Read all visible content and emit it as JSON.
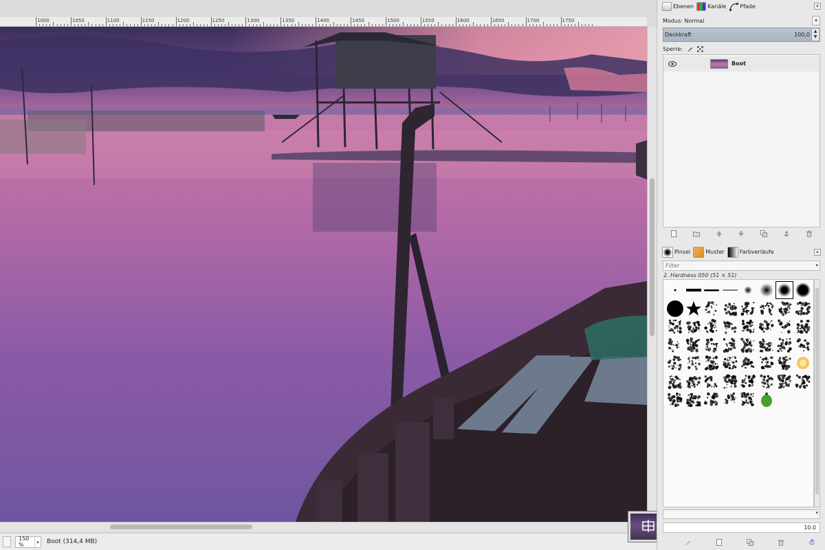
{
  "canvas": {
    "ruler_labels": [
      "1000",
      "1050",
      "1100",
      "1150",
      "1200",
      "1250",
      "1300",
      "1350",
      "1400",
      "1450",
      "1500",
      "1550",
      "1600",
      "1650",
      "1700",
      "1750"
    ],
    "image_description_colors": {
      "sky_top": "#3b2d5a",
      "sky_glow": "#f08aa0",
      "water": "#a565a8"
    }
  },
  "statusbar": {
    "zoom": "150 %",
    "zoom_dropdown": "▾",
    "info": "Boot (314,4 MB)"
  },
  "dock": {
    "layers_tabs": [
      {
        "label": "Ebenen",
        "icon": "layers-icon"
      },
      {
        "label": "Kanäle",
        "icon": "channels-icon"
      },
      {
        "label": "Pfade",
        "icon": "paths-icon"
      }
    ],
    "mode_label": "Modus: Normal",
    "opacity_label": "Deckkraft",
    "opacity_value": "100,0",
    "lock_label": "Sperre:",
    "layers": [
      {
        "name": "Boot",
        "visible": true
      }
    ],
    "brush_tabs": [
      {
        "label": "Pinsel",
        "icon": "brush-icon"
      },
      {
        "label": "Muster",
        "icon": "pattern-icon"
      },
      {
        "label": "Farbverläufe",
        "icon": "gradient-icon"
      }
    ],
    "filter_placeholder": "Filter",
    "selected_brush": "2. Hardness 050 (51 × 51)",
    "spacing_value": "10.0"
  }
}
